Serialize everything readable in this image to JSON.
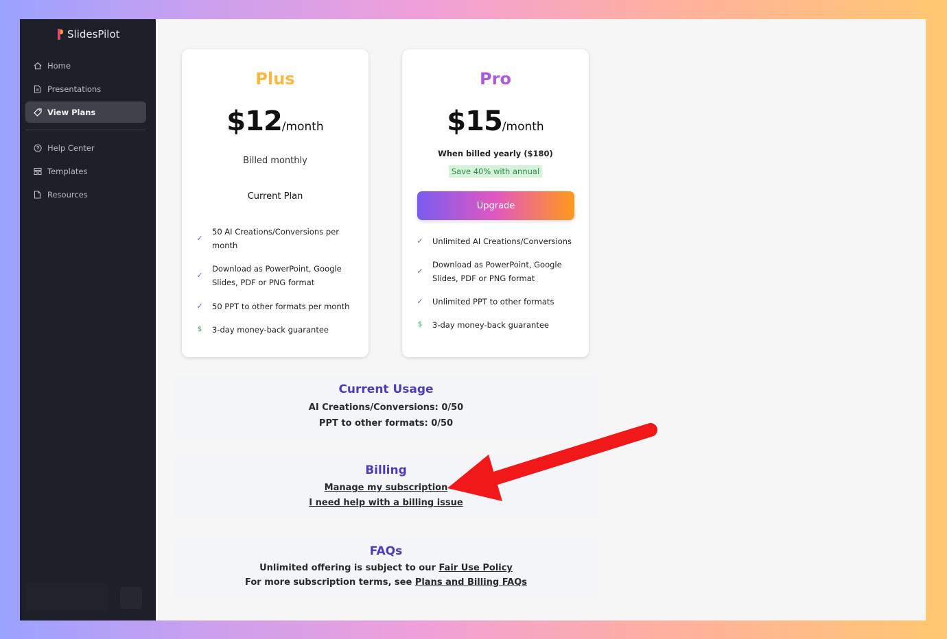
{
  "app": {
    "name": "SlidesPilot"
  },
  "sidebar": {
    "items": [
      {
        "label": "Home",
        "icon": "home-icon"
      },
      {
        "label": "Presentations",
        "icon": "document-icon"
      },
      {
        "label": "View Plans",
        "icon": "tag-icon",
        "active": true
      },
      {
        "label": "Help Center",
        "icon": "help-icon"
      },
      {
        "label": "Templates",
        "icon": "grid-icon"
      },
      {
        "label": "Resources",
        "icon": "file-icon"
      }
    ]
  },
  "plans": {
    "plus": {
      "name": "Plus",
      "price": "$12",
      "period": "/month",
      "billing": "Billed monthly",
      "status": "Current Plan",
      "features": [
        "50 AI Creations/Conversions per month",
        "Download as PowerPoint, Google Slides, PDF or PNG format",
        "50 PPT to other formats per month",
        "3-day money-back guarantee"
      ]
    },
    "pro": {
      "name": "Pro",
      "price": "$15",
      "period": "/month",
      "billing": "When billed yearly ($180)",
      "save": "Save 40% with annual",
      "cta": "Upgrade",
      "features": [
        "Unlimited AI Creations/Conversions",
        "Download as PowerPoint, Google Slides, PDF or PNG format",
        "Unlimited PPT to other formats",
        "3-day money-back guarantee"
      ]
    }
  },
  "usage": {
    "title": "Current Usage",
    "ai": "AI Creations/Conversions: 0/50",
    "ppt": "PPT to other formats: 0/50"
  },
  "billing": {
    "title": "Billing",
    "manage": "Manage my subscription",
    "help": "I need help with a billing issue"
  },
  "faqs": {
    "title": "FAQs",
    "line1_prefix": "Unlimited offering is subject to our",
    "line1_link": "Fair Use Policy",
    "line2_prefix": "For more subscription terms, see",
    "line2_link": "Plans and Billing FAQs"
  },
  "colors": {
    "accent": "#4b3cb8",
    "plus": "#f6b944",
    "annotation_arrow": "#f01818"
  }
}
